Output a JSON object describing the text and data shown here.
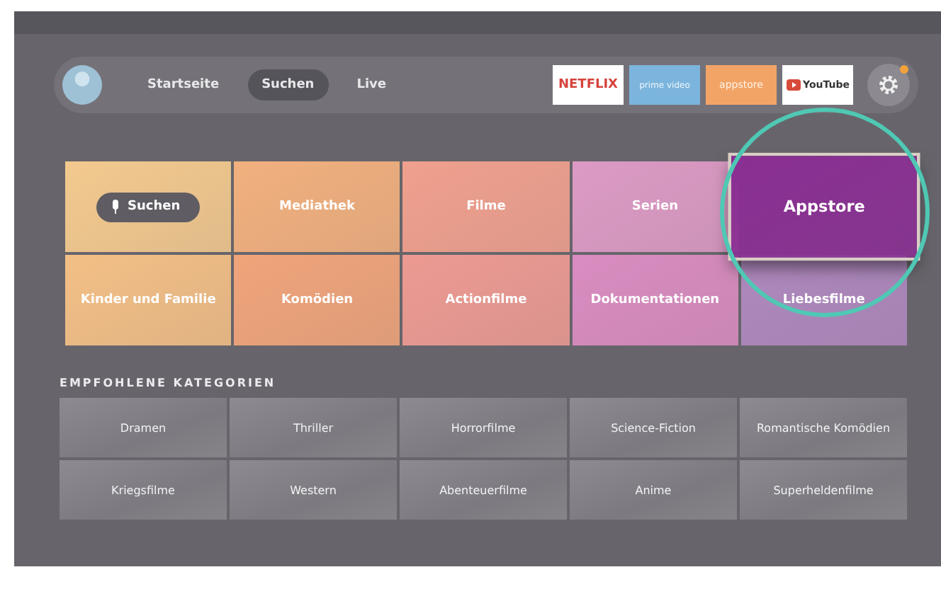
{
  "nav": {
    "tabs": [
      {
        "label": "Startseite",
        "selected": false
      },
      {
        "label": "Suchen",
        "selected": true
      },
      {
        "label": "Live",
        "selected": false
      }
    ],
    "apps": [
      {
        "kind": "netflix",
        "label": "NETFLIX"
      },
      {
        "kind": "prime",
        "label": "prime video"
      },
      {
        "kind": "appstore",
        "label": "appstore"
      },
      {
        "kind": "youtube",
        "label": "YouTube"
      }
    ],
    "settings": {
      "notification": true
    }
  },
  "tiles": [
    {
      "kind": "search",
      "label": "Suchen",
      "color": "#f3c98e",
      "selected": false
    },
    {
      "kind": "category",
      "label": "Mediathek",
      "color": "#f2b07e",
      "selected": false
    },
    {
      "kind": "category",
      "label": "Filme",
      "color": "#f0a08e",
      "selected": false
    },
    {
      "kind": "category",
      "label": "Serien",
      "color": "#dc9ac4",
      "selected": false
    },
    {
      "kind": "category",
      "label": "Appstore",
      "color": "#8a2f93",
      "selected": true
    },
    {
      "kind": "category",
      "label": "Kinder und Familie",
      "color": "#f3bf86",
      "selected": false
    },
    {
      "kind": "category",
      "label": "Komödien",
      "color": "#f0a47a",
      "selected": false
    },
    {
      "kind": "category",
      "label": "Actionfilme",
      "color": "#ec9a92",
      "selected": false
    },
    {
      "kind": "category",
      "label": "Dokumentationen",
      "color": "#d98cc0",
      "selected": false
    },
    {
      "kind": "category",
      "label": "Liebesfilme",
      "color": "#ae88bd",
      "selected": false
    }
  ],
  "recommended": {
    "title": "EMPFOHLENE KATEGORIEN",
    "items": [
      "Dramen",
      "Thriller",
      "Horrorfilme",
      "Science-Fiction",
      "Romantische Komödien",
      "Kriegsfilme",
      "Western",
      "Abenteuerfilme",
      "Anime",
      "Superheldenfilme"
    ]
  }
}
